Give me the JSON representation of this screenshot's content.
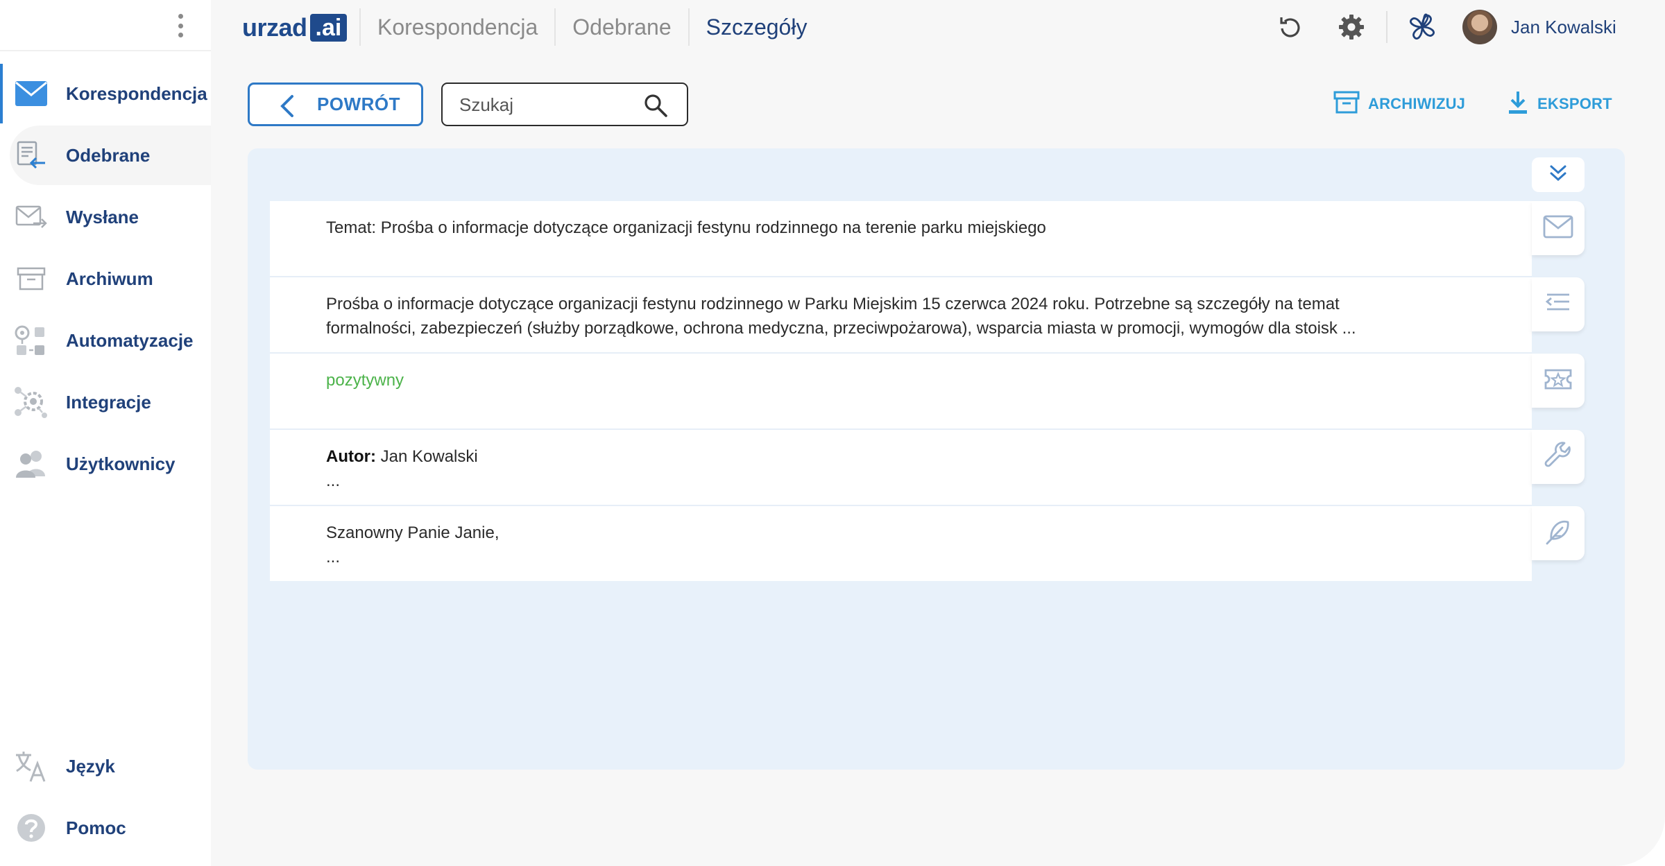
{
  "app": {
    "logo_text": "urzad",
    "logo_badge": ".ai"
  },
  "header": {
    "breadcrumbs": [
      "Korespondencja",
      "Odebrane",
      "Szczegóły"
    ],
    "user_name": "Jan Kowalski",
    "icons": [
      "refresh-icon",
      "gear-icon",
      "clover-icon"
    ]
  },
  "sidebar": {
    "items": [
      {
        "label": "Korespondencja",
        "icon": "envelope-icon"
      },
      {
        "label": "Odebrane",
        "icon": "inbox-icon"
      },
      {
        "label": "Wysłane",
        "icon": "sent-icon"
      },
      {
        "label": "Archiwum",
        "icon": "archive-icon"
      },
      {
        "label": "Automatyzacje",
        "icon": "automation-icon"
      },
      {
        "label": "Integracje",
        "icon": "integration-icon"
      },
      {
        "label": "Użytkownicy",
        "icon": "users-icon"
      }
    ],
    "bottom": [
      {
        "label": "Język",
        "icon": "translate-icon"
      },
      {
        "label": "Pomoc",
        "icon": "help-icon"
      }
    ]
  },
  "toolbar": {
    "back_label": "POWRÓT",
    "search_placeholder": "Szukaj",
    "archive_label": "ARCHIWIZUJ",
    "export_label": "EKSPORT"
  },
  "details": {
    "subject": "Temat: Prośba o informacje dotyczące organizacji festynu rodzinnego na terenie parku miejskiego",
    "summary_line1": "Prośba o informacje dotyczące organizacji festynu rodzinnego w Parku Miejskim 15 czerwca 2024 roku. Potrzebne są szczegóły na temat",
    "summary_line2": "formalności, zabezpieczeń (służby porządkowe, ochrona medyczna, przeciwpożarowa), wsparcia miasta w promocji, wymogów dla stoisk ...",
    "sentiment": "pozytywny",
    "author_label": "Autor:",
    "author_name": " Jan Kowalski",
    "author_more": "...",
    "reply_greeting": "Szanowny Panie Janie,",
    "reply_more": "..."
  },
  "colors": {
    "accent": "#2e79c6",
    "nav_text": "#20417a",
    "action_text": "#2e9cd9",
    "panel_bg": "#e8f1fa",
    "sentiment_positive": "#4cb34a"
  }
}
